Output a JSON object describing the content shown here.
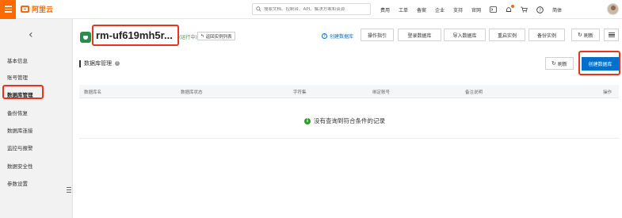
{
  "topbar": {
    "logo_text": "阿里云",
    "search_placeholder": "搜索文档、控制台、API、解决方案和资源",
    "links": [
      "费用",
      "工单",
      "备案",
      "企业",
      "支持",
      "官网"
    ],
    "icons": [
      "terminal-icon",
      "bell-icon",
      "cart-icon",
      "help-icon"
    ],
    "lang": "简体",
    "accent": "#ff6a00"
  },
  "sidebar": {
    "back_glyph": "‹",
    "items": [
      {
        "label": "基本信息",
        "active": false
      },
      {
        "label": "账号管理",
        "active": false
      },
      {
        "label": "数据库管理",
        "active": true
      },
      {
        "label": "备份恢复",
        "active": false
      },
      {
        "label": "数据库连接",
        "active": false
      },
      {
        "label": "监控与报警",
        "active": false
      },
      {
        "label": "数据安全性",
        "active": false
      },
      {
        "label": "参数设置",
        "active": false
      }
    ]
  },
  "header": {
    "instance_name": "rm-uf619mh5r...",
    "status": "(运行中)",
    "back_to_list": "返回实例列表",
    "help_link": "创建数据库",
    "buttons": [
      "操作指引",
      "登录数据库",
      "导入数据库",
      "重启实例",
      "备份实例",
      "刷新"
    ]
  },
  "section": {
    "title": "数据库管理",
    "refresh_label": "刷新",
    "create_label": "创建数据库",
    "primary_color": "#0070cc"
  },
  "table": {
    "columns": [
      "数据库名",
      "数据库状态",
      "字符集",
      "绑定账号",
      "备注说明",
      "操作"
    ],
    "empty_text": "没有查询到符合条件的记录"
  }
}
